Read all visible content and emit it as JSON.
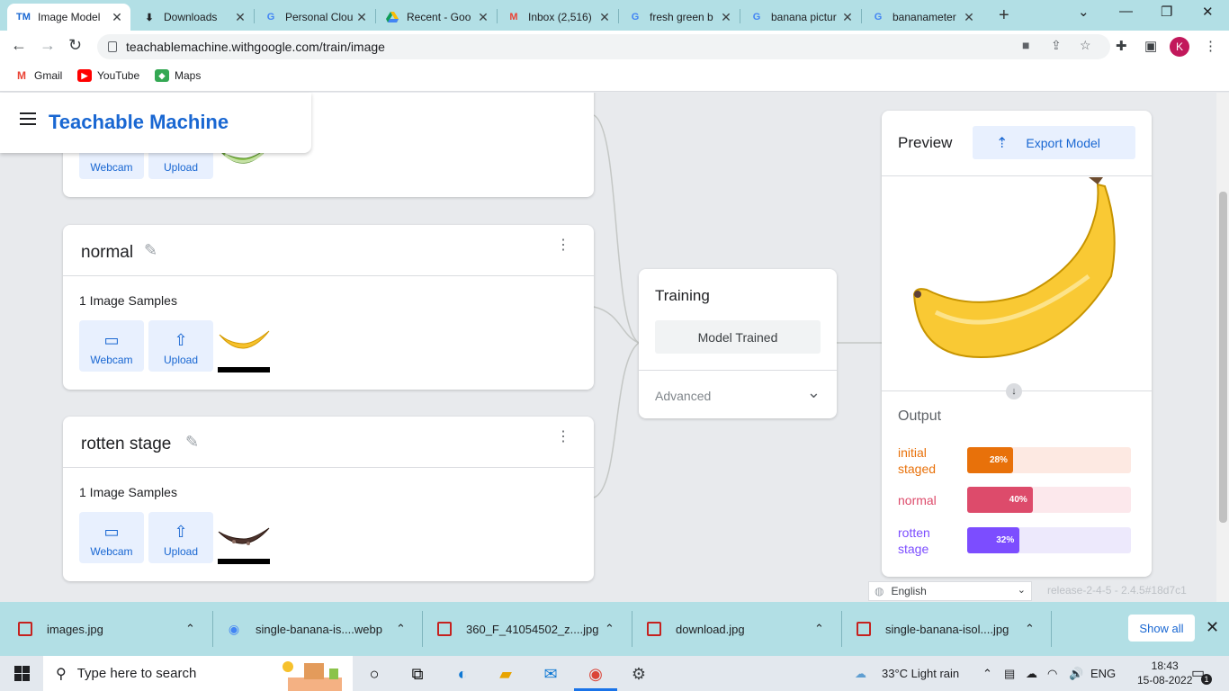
{
  "browser": {
    "tabs": [
      {
        "title": "Image Model",
        "favicon": "TM"
      },
      {
        "title": "Downloads",
        "favicon": "download-icon"
      },
      {
        "title": "Personal Clou",
        "favicon": "G"
      },
      {
        "title": "Recent - Goo",
        "favicon": "drive-icon"
      },
      {
        "title": "Inbox (2,516)",
        "favicon": "M"
      },
      {
        "title": "fresh green b",
        "favicon": "G"
      },
      {
        "title": "banana pictur",
        "favicon": "G"
      },
      {
        "title": "bananameter",
        "favicon": "G"
      }
    ],
    "url": "teachablemachine.withgoogle.com/train/image",
    "profile_initial": "K",
    "bookmarks": [
      {
        "label": "Gmail",
        "icon": "gmail-icon"
      },
      {
        "label": "YouTube",
        "icon": "youtube-icon"
      },
      {
        "label": "Maps",
        "icon": "maps-icon"
      }
    ]
  },
  "app": {
    "brand": "Teachable Machine",
    "classes": [
      {
        "name": "",
        "samples": "",
        "webcam": "Webcam",
        "upload": "Upload"
      },
      {
        "name": "normal",
        "samples": "1 Image Samples",
        "webcam": "Webcam",
        "upload": "Upload"
      },
      {
        "name": "rotten stage",
        "samples": "1 Image Samples",
        "webcam": "Webcam",
        "upload": "Upload"
      }
    ],
    "training": {
      "title": "Training",
      "status_button": "Model Trained",
      "advanced": "Advanced"
    },
    "preview": {
      "title": "Preview",
      "export_label": "Export Model",
      "output_title": "Output",
      "outputs": [
        {
          "label": "initial staged",
          "percent": 28,
          "text": "28%",
          "color": "#e8710a",
          "track": "#fde9e2"
        },
        {
          "label": "normal",
          "percent": 40,
          "text": "40%",
          "color": "#dd4b6b",
          "track": "#fce8ec"
        },
        {
          "label": "rotten stage",
          "percent": 32,
          "text": "32%",
          "color": "#7c4dff",
          "track": "#ede9fc"
        }
      ]
    },
    "language": "English",
    "release": "release-2-4-5 - 2.4.5#18d7c1"
  },
  "downloads": {
    "items": [
      {
        "name": "images.jpg"
      },
      {
        "name": "single-banana-is....webp"
      },
      {
        "name": "360_F_41054502_z....jpg"
      },
      {
        "name": "download.jpg"
      },
      {
        "name": "single-banana-isol....jpg"
      }
    ],
    "show_all": "Show all"
  },
  "taskbar": {
    "search_placeholder": "Type here to search",
    "weather": "33°C  Light rain",
    "lang": "ENG",
    "time": "18:43",
    "date": "15-08-2022",
    "notif_count": "1"
  },
  "colors": {
    "accent": "#1967d2",
    "chrome_frame": "#b2dfe5"
  }
}
